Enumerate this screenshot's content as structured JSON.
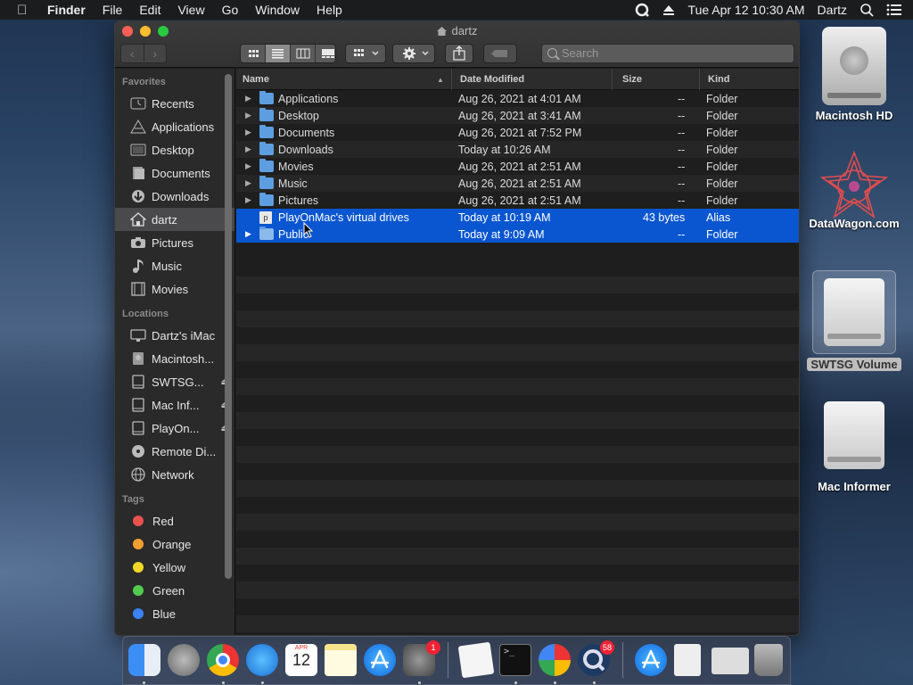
{
  "menubar": {
    "apple": "",
    "items": [
      "Finder",
      "File",
      "Edit",
      "View",
      "Go",
      "Window",
      "Help"
    ],
    "datetime": "Tue Apr 12  10:30 AM",
    "user": "Dartz"
  },
  "window": {
    "title": "dartz",
    "search_placeholder": "Search"
  },
  "sidebar": {
    "favorites_header": "Favorites",
    "favorites": [
      "Recents",
      "Applications",
      "Desktop",
      "Documents",
      "Downloads",
      "dartz",
      "Pictures",
      "Music",
      "Movies"
    ],
    "locations_header": "Locations",
    "locations": [
      "Dartz's iMac",
      "Macintosh...",
      "SWTSG...",
      "Mac Inf...",
      "PlayOn...",
      "Remote Di...",
      "Network"
    ],
    "tags_header": "Tags",
    "tags": [
      {
        "label": "Red",
        "color": "#e8524f"
      },
      {
        "label": "Orange",
        "color": "#f0a030"
      },
      {
        "label": "Yellow",
        "color": "#f0d82a"
      },
      {
        "label": "Green",
        "color": "#52cc4f"
      },
      {
        "label": "Blue",
        "color": "#3b82f6"
      }
    ]
  },
  "columns": {
    "name": "Name",
    "date": "Date Modified",
    "size": "Size",
    "kind": "Kind"
  },
  "rows": [
    {
      "name": "Applications",
      "date": "Aug 26, 2021 at 4:01 AM",
      "size": "--",
      "kind": "Folder"
    },
    {
      "name": "Desktop",
      "date": "Aug 26, 2021 at 3:41 AM",
      "size": "--",
      "kind": "Folder"
    },
    {
      "name": "Documents",
      "date": "Aug 26, 2021 at 7:52 PM",
      "size": "--",
      "kind": "Folder"
    },
    {
      "name": "Downloads",
      "date": "Today at 10:26 AM",
      "size": "--",
      "kind": "Folder"
    },
    {
      "name": "Movies",
      "date": "Aug 26, 2021 at 2:51 AM",
      "size": "--",
      "kind": "Folder"
    },
    {
      "name": "Music",
      "date": "Aug 26, 2021 at 2:51 AM",
      "size": "--",
      "kind": "Folder"
    },
    {
      "name": "Pictures",
      "date": "Aug 26, 2021 at 2:51 AM",
      "size": "--",
      "kind": "Folder"
    },
    {
      "name": "PlayOnMac's virtual drives",
      "date": "Today at 10:19 AM",
      "size": "43 bytes",
      "kind": "Alias"
    },
    {
      "name": "Public",
      "date": "Today at 9:09 AM",
      "size": "--",
      "kind": "Folder"
    }
  ],
  "desktop": [
    "Macintosh HD",
    "DataWagon.com",
    "SWTSG Volume",
    "Mac Informer"
  ],
  "dock": {
    "calendar_month": "APR",
    "calendar_day": "12",
    "prefs_badge": "1",
    "qt_badge": "58"
  }
}
